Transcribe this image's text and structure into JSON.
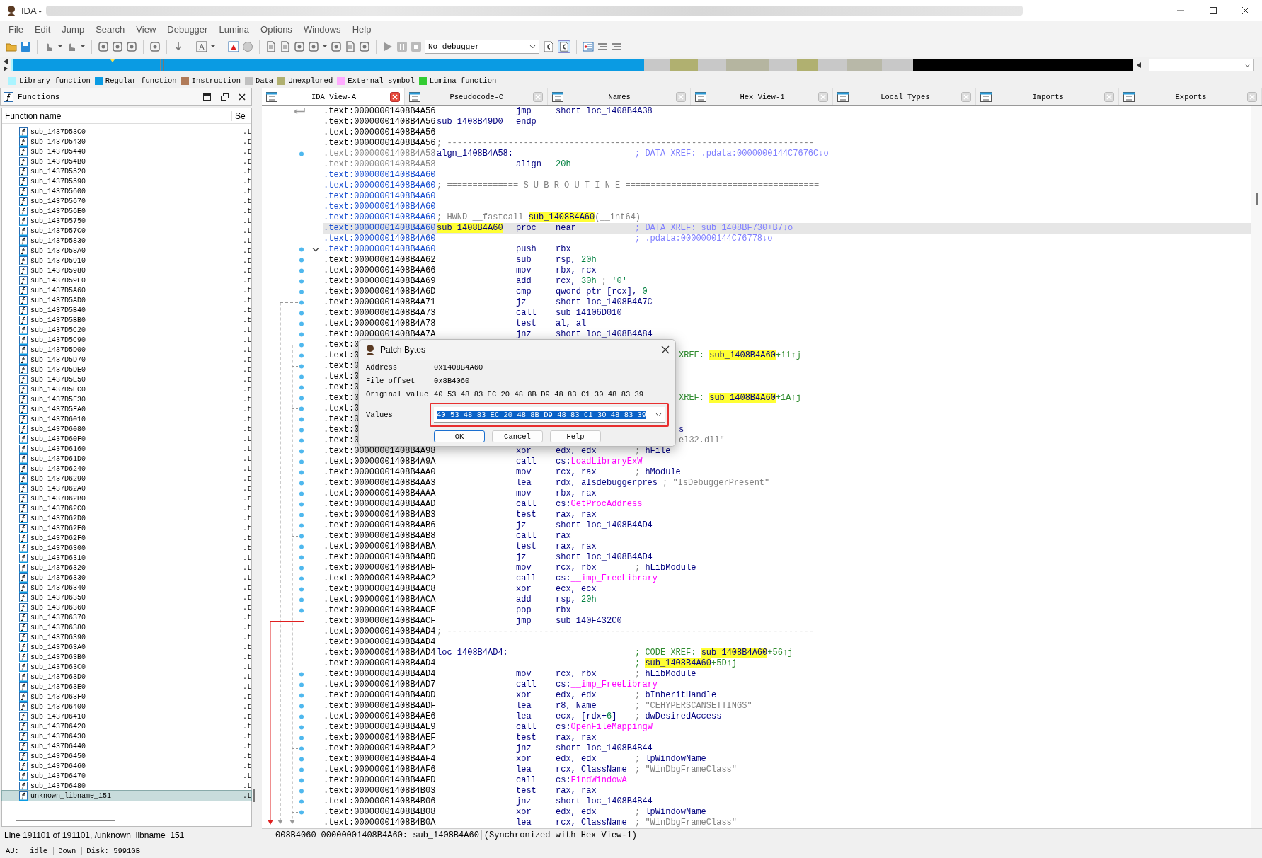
{
  "window": {
    "title": "IDA -"
  },
  "menu": [
    "File",
    "Edit",
    "Jump",
    "Search",
    "View",
    "Debugger",
    "Lumina",
    "Options",
    "Windows",
    "Help"
  ],
  "toolbar": {
    "debugger_select": "No debugger"
  },
  "legend": [
    {
      "label": "Library function",
      "color": "#aaf4ff"
    },
    {
      "label": "Regular function",
      "color": "#0a9be3"
    },
    {
      "label": "Instruction",
      "color": "#b07a58"
    },
    {
      "label": "Data",
      "color": "#c0c0c0"
    },
    {
      "label": "Unexplored",
      "color": "#b0b070"
    },
    {
      "label": "External symbol",
      "color": "#ffaaff"
    },
    {
      "label": "Lumina function",
      "color": "#33cc33"
    }
  ],
  "functions_panel": {
    "title": "Functions",
    "columns": [
      "Function name",
      "Se"
    ],
    "rows": [
      {
        "name": "sub_1437D53C0",
        "segment": ".t",
        "selected": false
      },
      {
        "name": "sub_1437D5430",
        "segment": ".t",
        "selected": false
      },
      {
        "name": "sub_1437D5440",
        "segment": ".t",
        "selected": false
      },
      {
        "name": "sub_1437D54B0",
        "segment": ".t",
        "selected": false
      },
      {
        "name": "sub_1437D5520",
        "segment": ".t",
        "selected": false
      },
      {
        "name": "sub_1437D5590",
        "segment": ".t",
        "selected": false
      },
      {
        "name": "sub_1437D5600",
        "segment": ".t",
        "selected": false
      },
      {
        "name": "sub_1437D5670",
        "segment": ".t",
        "selected": false
      },
      {
        "name": "sub_1437D56E0",
        "segment": ".t",
        "selected": false
      },
      {
        "name": "sub_1437D5750",
        "segment": ".t",
        "selected": false
      },
      {
        "name": "sub_1437D57C0",
        "segment": ".t",
        "selected": false
      },
      {
        "name": "sub_1437D5830",
        "segment": ".t",
        "selected": false
      },
      {
        "name": "sub_1437D58A0",
        "segment": ".t",
        "selected": false
      },
      {
        "name": "sub_1437D5910",
        "segment": ".t",
        "selected": false
      },
      {
        "name": "sub_1437D5980",
        "segment": ".t",
        "selected": false
      },
      {
        "name": "sub_1437D59F0",
        "segment": ".t",
        "selected": false
      },
      {
        "name": "sub_1437D5A60",
        "segment": ".t",
        "selected": false
      },
      {
        "name": "sub_1437D5AD0",
        "segment": ".t",
        "selected": false
      },
      {
        "name": "sub_1437D5B40",
        "segment": ".t",
        "selected": false
      },
      {
        "name": "sub_1437D5BB0",
        "segment": ".t",
        "selected": false
      },
      {
        "name": "sub_1437D5C20",
        "segment": ".t",
        "selected": false
      },
      {
        "name": "sub_1437D5C90",
        "segment": ".t",
        "selected": false
      },
      {
        "name": "sub_1437D5D00",
        "segment": ".t",
        "selected": false
      },
      {
        "name": "sub_1437D5D70",
        "segment": ".t",
        "selected": false
      },
      {
        "name": "sub_1437D5DE0",
        "segment": ".t",
        "selected": false
      },
      {
        "name": "sub_1437D5E50",
        "segment": ".t",
        "selected": false
      },
      {
        "name": "sub_1437D5EC0",
        "segment": ".t",
        "selected": false
      },
      {
        "name": "sub_1437D5F30",
        "segment": ".t",
        "selected": false
      },
      {
        "name": "sub_1437D5FA0",
        "segment": ".t",
        "selected": false
      },
      {
        "name": "sub_1437D6010",
        "segment": ".t",
        "selected": false
      },
      {
        "name": "sub_1437D6080",
        "segment": ".t",
        "selected": false
      },
      {
        "name": "sub_1437D60F0",
        "segment": ".t",
        "selected": false
      },
      {
        "name": "sub_1437D6160",
        "segment": ".t",
        "selected": false
      },
      {
        "name": "sub_1437D61D0",
        "segment": ".t",
        "selected": false
      },
      {
        "name": "sub_1437D6240",
        "segment": ".t",
        "selected": false
      },
      {
        "name": "sub_1437D6290",
        "segment": ".t",
        "selected": false
      },
      {
        "name": "sub_1437D62A0",
        "segment": ".t",
        "selected": false
      },
      {
        "name": "sub_1437D62B0",
        "segment": ".t",
        "selected": false
      },
      {
        "name": "sub_1437D62C0",
        "segment": ".t",
        "selected": false
      },
      {
        "name": "sub_1437D62D0",
        "segment": ".t",
        "selected": false
      },
      {
        "name": "sub_1437D62E0",
        "segment": ".t",
        "selected": false
      },
      {
        "name": "sub_1437D62F0",
        "segment": ".t",
        "selected": false
      },
      {
        "name": "sub_1437D6300",
        "segment": ".t",
        "selected": false
      },
      {
        "name": "sub_1437D6310",
        "segment": ".t",
        "selected": false
      },
      {
        "name": "sub_1437D6320",
        "segment": ".t",
        "selected": false
      },
      {
        "name": "sub_1437D6330",
        "segment": ".t",
        "selected": false
      },
      {
        "name": "sub_1437D6340",
        "segment": ".t",
        "selected": false
      },
      {
        "name": "sub_1437D6350",
        "segment": ".t",
        "selected": false
      },
      {
        "name": "sub_1437D6360",
        "segment": ".t",
        "selected": false
      },
      {
        "name": "sub_1437D6370",
        "segment": ".t",
        "selected": false
      },
      {
        "name": "sub_1437D6380",
        "segment": ".t",
        "selected": false
      },
      {
        "name": "sub_1437D6390",
        "segment": ".t",
        "selected": false
      },
      {
        "name": "sub_1437D63A0",
        "segment": ".t",
        "selected": false
      },
      {
        "name": "sub_1437D63B0",
        "segment": ".t",
        "selected": false
      },
      {
        "name": "sub_1437D63C0",
        "segment": ".t",
        "selected": false
      },
      {
        "name": "sub_1437D63D0",
        "segment": ".t",
        "selected": false
      },
      {
        "name": "sub_1437D63E0",
        "segment": ".t",
        "selected": false
      },
      {
        "name": "sub_1437D63F0",
        "segment": ".t",
        "selected": false
      },
      {
        "name": "sub_1437D6400",
        "segment": ".t",
        "selected": false
      },
      {
        "name": "sub_1437D6410",
        "segment": ".t",
        "selected": false
      },
      {
        "name": "sub_1437D6420",
        "segment": ".t",
        "selected": false
      },
      {
        "name": "sub_1437D6430",
        "segment": ".t",
        "selected": false
      },
      {
        "name": "sub_1437D6440",
        "segment": ".t",
        "selected": false
      },
      {
        "name": "sub_1437D6450",
        "segment": ".t",
        "selected": false
      },
      {
        "name": "sub_1437D6460",
        "segment": ".t",
        "selected": false
      },
      {
        "name": "sub_1437D6470",
        "segment": ".t",
        "selected": false
      },
      {
        "name": "sub_1437D6480",
        "segment": ".t",
        "selected": false
      },
      {
        "name": "unknown_libname_151",
        "segment": ".t",
        "selected": true
      }
    ],
    "status": "Line 191101 of 191101, /unknown_libname_151"
  },
  "tabs": [
    {
      "label": "IDA View-A",
      "selected": true
    },
    {
      "label": "Pseudocode-C",
      "selected": false
    },
    {
      "label": "Names",
      "selected": false
    },
    {
      "label": "Hex View-1",
      "selected": false
    },
    {
      "label": "Local Types",
      "selected": false
    },
    {
      "label": "Imports",
      "selected": false
    },
    {
      "label": "Exports",
      "selected": false
    }
  ],
  "listing": {
    "rows": [
      {
        "address": ".text:00000001408B4A56",
        "color": "#000000",
        "dot": false,
        "selected": false,
        "mnemonic": "jmp",
        "operands": [
          {
            "text": "short loc_1408B4A38",
            "kind": "name"
          }
        ]
      },
      {
        "address": ".text:00000001408B4A56",
        "color": "#000000",
        "dot": false,
        "selected": false,
        "label": [
          {
            "text": "sub_1408B49D0",
            "kind": "name"
          }
        ],
        "mnemonic": "endp"
      },
      {
        "address": ".text:00000001408B4A56",
        "color": "#000000",
        "dot": false,
        "selected": false
      },
      {
        "address": ".text:00000001408B4A56",
        "color": "#000000",
        "dot": false,
        "selected": false,
        "note": [
          {
            "text": "; ------------------------------------------------------------------------",
            "kind": "gray"
          }
        ]
      },
      {
        "address": ".text:00000001408B4A58",
        "color": "#888888",
        "dot": true,
        "selected": false,
        "label": [
          {
            "text": "algn_1408B4A58:",
            "kind": "name"
          }
        ],
        "comment": [
          {
            "text": "; DATA XREF: .pdata:0000000144C7676C↓o",
            "kind": "xref"
          }
        ]
      },
      {
        "address": ".text:00000001408B4A58",
        "color": "#888888",
        "dot": false,
        "selected": false,
        "mnemonic": "align",
        "operands": [
          {
            "text": "20h",
            "kind": "num"
          }
        ]
      },
      {
        "address": ".text:00000001408B4A60",
        "color": "#1a4fd0",
        "dot": false,
        "selected": false
      },
      {
        "address": ".text:00000001408B4A60",
        "color": "#1a4fd0",
        "dot": false,
        "selected": false,
        "note": [
          {
            "text": "; ============== S U B R O U T I N E ======================================",
            "kind": "gray"
          }
        ]
      },
      {
        "address": ".text:00000001408B4A60",
        "color": "#1a4fd0",
        "dot": false,
        "selected": false
      },
      {
        "address": ".text:00000001408B4A60",
        "color": "#1a4fd0",
        "dot": false,
        "selected": false
      },
      {
        "address": ".text:00000001408B4A60",
        "color": "#1a4fd0",
        "dot": false,
        "selected": false,
        "note": [
          {
            "text": "; HWND __fastcall ",
            "kind": "gray"
          },
          {
            "text": "sub_1408B4A60",
            "kind": "hl"
          },
          {
            "text": "(__int64)",
            "kind": "gray"
          }
        ]
      },
      {
        "address": ".text:00000001408B4A60",
        "color": "#1a4fd0",
        "dot": false,
        "selected": true,
        "label": [
          {
            "text": "sub_1408B4A60",
            "kind": "hl"
          }
        ],
        "mnemonic": "proc",
        "operands": [
          {
            "text": "near",
            "kind": "name"
          }
        ],
        "comment": [
          {
            "text": "; DATA XREF: sub_1408BF730+B7↓o",
            "kind": "xref"
          }
        ]
      },
      {
        "address": ".text:00000001408B4A60",
        "color": "#1a4fd0",
        "dot": false,
        "selected": false,
        "comment": [
          {
            "text": "; .pdata:0000000144C76778↓o",
            "kind": "xref"
          }
        ]
      },
      {
        "address": ".text:00000001408B4A60",
        "color": "#1a4fd0",
        "dot": true,
        "selected": false,
        "mnemonic": "push",
        "operands": [
          {
            "text": "rbx",
            "kind": "name"
          }
        ]
      },
      {
        "address": ".text:00000001408B4A62",
        "color": "#000000",
        "dot": true,
        "selected": false,
        "mnemonic": "sub",
        "operands": [
          {
            "text": "rsp, ",
            "kind": "name"
          },
          {
            "text": "20h",
            "kind": "num"
          }
        ]
      },
      {
        "address": ".text:00000001408B4A66",
        "color": "#000000",
        "dot": true,
        "selected": false,
        "mnemonic": "mov",
        "operands": [
          {
            "text": "rbx, rcx",
            "kind": "name"
          }
        ]
      },
      {
        "address": ".text:00000001408B4A69",
        "color": "#000000",
        "dot": true,
        "selected": false,
        "mnemonic": "add",
        "operands": [
          {
            "text": "rcx, ",
            "kind": "name"
          },
          {
            "text": "30h",
            "kind": "num"
          },
          {
            "text": " ; ",
            "kind": "gray"
          },
          {
            "text": "'0'",
            "kind": "num"
          }
        ]
      },
      {
        "address": ".text:00000001408B4A6D",
        "color": "#000000",
        "dot": true,
        "selected": false,
        "mnemonic": "cmp",
        "operands": [
          {
            "text": "qword ptr [rcx], ",
            "kind": "name"
          },
          {
            "text": "0",
            "kind": "num"
          }
        ]
      },
      {
        "address": ".text:00000001408B4A71",
        "color": "#000000",
        "dot": true,
        "selected": false,
        "mnemonic": "jz",
        "operands": [
          {
            "text": "short loc_1408B4A7C",
            "kind": "name"
          }
        ]
      },
      {
        "address": ".text:00000001408B4A73",
        "color": "#000000",
        "dot": true,
        "selected": false,
        "mnemonic": "call",
        "operands": [
          {
            "text": "sub_14106D010",
            "kind": "name"
          }
        ]
      },
      {
        "address": ".text:00000001408B4A78",
        "color": "#000000",
        "dot": true,
        "selected": false,
        "mnemonic": "test",
        "operands": [
          {
            "text": "al, al",
            "kind": "name"
          }
        ]
      },
      {
        "address": ".text:00000001408B4A7A",
        "color": "#000000",
        "dot": true,
        "selected": false,
        "mnemonic": "jnz",
        "operands": [
          {
            "text": "short loc_1408B4A84",
            "kind": "name"
          }
        ]
      },
      {
        "address": ".text:0",
        "color": "#000000",
        "dot": true,
        "selected": false,
        "covered": true
      },
      {
        "address": ".text:0",
        "color": "#000000",
        "dot": true,
        "selected": false,
        "covered": true,
        "comment": [
          {
            "text": "XREF: ",
            "kind": "code"
          },
          {
            "text": "sub_1408B4A60",
            "kind": "hl"
          },
          {
            "text": "+11↑j",
            "kind": "code"
          }
        ]
      },
      {
        "address": ".text:0",
        "color": "#000000",
        "dot": true,
        "selected": false,
        "covered": true
      },
      {
        "address": ".text:0",
        "color": "#000000",
        "dot": true,
        "selected": false,
        "covered": true
      },
      {
        "address": ".text:0",
        "color": "#000000",
        "dot": true,
        "selected": false,
        "covered": true
      },
      {
        "address": ".text:0",
        "color": "#000000",
        "dot": true,
        "selected": false,
        "covered": true,
        "comment": [
          {
            "text": "XREF: ",
            "kind": "code"
          },
          {
            "text": "sub_1408B4A60",
            "kind": "hl"
          },
          {
            "text": "+1A↑j",
            "kind": "code"
          }
        ]
      },
      {
        "address": ".text:0",
        "color": "#000000",
        "dot": true,
        "selected": false,
        "covered": true
      },
      {
        "address": ".text:0",
        "color": "#000000",
        "dot": true,
        "selected": false,
        "covered": true
      },
      {
        "address": ".text:0",
        "color": "#000000",
        "dot": true,
        "selected": false,
        "covered": true,
        "comment": [
          {
            "text": "s",
            "kind": "name"
          }
        ]
      },
      {
        "address": ".text:0",
        "color": "#000000",
        "dot": true,
        "selected": false,
        "covered": true,
        "comment": [
          {
            "text": "el32.dll\"",
            "kind": "gray"
          }
        ]
      },
      {
        "address": ".text:00000001408B4A98",
        "color": "#000000",
        "dot": true,
        "selected": false,
        "mnemonic": "xor",
        "operands": [
          {
            "text": "edx, edx",
            "kind": "name"
          }
        ],
        "comment": [
          {
            "text": "; ",
            "kind": "gray"
          },
          {
            "text": "hFile",
            "kind": "name"
          }
        ]
      },
      {
        "address": ".text:00000001408B4A9A",
        "color": "#000000",
        "dot": true,
        "selected": false,
        "mnemonic": "call",
        "operands": [
          {
            "text": "cs:",
            "kind": "name"
          },
          {
            "text": "LoadLibraryExW",
            "kind": "import"
          }
        ]
      },
      {
        "address": ".text:00000001408B4AA0",
        "color": "#000000",
        "dot": true,
        "selected": false,
        "mnemonic": "mov",
        "operands": [
          {
            "text": "rcx, rax",
            "kind": "name"
          }
        ],
        "comment": [
          {
            "text": "; ",
            "kind": "gray"
          },
          {
            "text": "hModule",
            "kind": "name"
          }
        ]
      },
      {
        "address": ".text:00000001408B4AA3",
        "color": "#000000",
        "dot": true,
        "selected": false,
        "mnemonic": "lea",
        "operands": [
          {
            "text": "rdx, aIsdebuggerpres",
            "kind": "name"
          }
        ],
        "comment": [
          {
            "text": "; \"IsDebuggerPresent\"",
            "kind": "gray"
          }
        ]
      },
      {
        "address": ".text:00000001408B4AAA",
        "color": "#000000",
        "dot": true,
        "selected": false,
        "mnemonic": "mov",
        "operands": [
          {
            "text": "rbx, rax",
            "kind": "name"
          }
        ]
      },
      {
        "address": ".text:00000001408B4AAD",
        "color": "#000000",
        "dot": true,
        "selected": false,
        "mnemonic": "call",
        "operands": [
          {
            "text": "cs:",
            "kind": "name"
          },
          {
            "text": "GetProcAddress",
            "kind": "import"
          }
        ]
      },
      {
        "address": ".text:00000001408B4AB3",
        "color": "#000000",
        "dot": true,
        "selected": false,
        "mnemonic": "test",
        "operands": [
          {
            "text": "rax, rax",
            "kind": "name"
          }
        ]
      },
      {
        "address": ".text:00000001408B4AB6",
        "color": "#000000",
        "dot": true,
        "selected": false,
        "mnemonic": "jz",
        "operands": [
          {
            "text": "short loc_1408B4AD4",
            "kind": "name"
          }
        ]
      },
      {
        "address": ".text:00000001408B4AB8",
        "color": "#000000",
        "dot": true,
        "selected": false,
        "mnemonic": "call",
        "operands": [
          {
            "text": "rax",
            "kind": "name"
          }
        ]
      },
      {
        "address": ".text:00000001408B4ABA",
        "color": "#000000",
        "dot": true,
        "selected": false,
        "mnemonic": "test",
        "operands": [
          {
            "text": "rax, rax",
            "kind": "name"
          }
        ]
      },
      {
        "address": ".text:00000001408B4ABD",
        "color": "#000000",
        "dot": true,
        "selected": false,
        "mnemonic": "jz",
        "operands": [
          {
            "text": "short loc_1408B4AD4",
            "kind": "name"
          }
        ]
      },
      {
        "address": ".text:00000001408B4ABF",
        "color": "#000000",
        "dot": true,
        "selected": false,
        "mnemonic": "mov",
        "operands": [
          {
            "text": "rcx, rbx",
            "kind": "name"
          }
        ],
        "comment": [
          {
            "text": "; ",
            "kind": "gray"
          },
          {
            "text": "hLibModule",
            "kind": "name"
          }
        ]
      },
      {
        "address": ".text:00000001408B4AC2",
        "color": "#000000",
        "dot": true,
        "selected": false,
        "mnemonic": "call",
        "operands": [
          {
            "text": "cs:",
            "kind": "name"
          },
          {
            "text": "__imp_FreeLibrary",
            "kind": "import"
          }
        ]
      },
      {
        "address": ".text:00000001408B4AC8",
        "color": "#000000",
        "dot": true,
        "selected": false,
        "mnemonic": "xor",
        "operands": [
          {
            "text": "ecx, ecx",
            "kind": "name"
          }
        ]
      },
      {
        "address": ".text:00000001408B4ACA",
        "color": "#000000",
        "dot": true,
        "selected": false,
        "mnemonic": "add",
        "operands": [
          {
            "text": "rsp, ",
            "kind": "name"
          },
          {
            "text": "20h",
            "kind": "num"
          }
        ]
      },
      {
        "address": ".text:00000001408B4ACE",
        "color": "#000000",
        "dot": true,
        "selected": false,
        "mnemonic": "pop",
        "operands": [
          {
            "text": "rbx",
            "kind": "name"
          }
        ]
      },
      {
        "address": ".text:00000001408B4ACF",
        "color": "#000000",
        "dot": false,
        "selected": false,
        "mnemonic": "jmp",
        "operands": [
          {
            "text": "sub_140F432C0",
            "kind": "name"
          }
        ]
      },
      {
        "address": ".text:00000001408B4AD4",
        "color": "#000000",
        "dot": false,
        "selected": false,
        "note": [
          {
            "text": "; ------------------------------------------------------------------------",
            "kind": "gray"
          }
        ]
      },
      {
        "address": ".text:00000001408B4AD4",
        "color": "#000000",
        "dot": false,
        "selected": false
      },
      {
        "address": ".text:00000001408B4AD4",
        "color": "#000000",
        "dot": false,
        "selected": false,
        "label": [
          {
            "text": "loc_1408B4AD4:",
            "kind": "name"
          }
        ],
        "comment": [
          {
            "text": "; CODE XREF: ",
            "kind": "code"
          },
          {
            "text": "sub_1408B4A60",
            "kind": "hl"
          },
          {
            "text": "+56↑j",
            "kind": "code"
          }
        ]
      },
      {
        "address": ".text:00000001408B4AD4",
        "color": "#000000",
        "dot": false,
        "selected": false,
        "comment": [
          {
            "text": "; ",
            "kind": "code"
          },
          {
            "text": "sub_1408B4A60",
            "kind": "hl"
          },
          {
            "text": "+5D↑j",
            "kind": "code"
          }
        ]
      },
      {
        "address": ".text:00000001408B4AD4",
        "color": "#000000",
        "dot": true,
        "selected": false,
        "mnemonic": "mov",
        "operands": [
          {
            "text": "rcx, rbx",
            "kind": "name"
          }
        ],
        "comment": [
          {
            "text": "; ",
            "kind": "gray"
          },
          {
            "text": "hLibModule",
            "kind": "name"
          }
        ]
      },
      {
        "address": ".text:00000001408B4AD7",
        "color": "#000000",
        "dot": true,
        "selected": false,
        "mnemonic": "call",
        "operands": [
          {
            "text": "cs:",
            "kind": "name"
          },
          {
            "text": "__imp_FreeLibrary",
            "kind": "import"
          }
        ]
      },
      {
        "address": ".text:00000001408B4ADD",
        "color": "#000000",
        "dot": true,
        "selected": false,
        "mnemonic": "xor",
        "operands": [
          {
            "text": "edx, edx",
            "kind": "name"
          }
        ],
        "comment": [
          {
            "text": "; ",
            "kind": "gray"
          },
          {
            "text": "bInheritHandle",
            "kind": "name"
          }
        ]
      },
      {
        "address": ".text:00000001408B4ADF",
        "color": "#000000",
        "dot": true,
        "selected": false,
        "mnemonic": "lea",
        "operands": [
          {
            "text": "r8, Name",
            "kind": "name"
          }
        ],
        "comment": [
          {
            "text": "; \"CEHYPERSCANSETTINGS\"",
            "kind": "gray"
          }
        ]
      },
      {
        "address": ".text:00000001408B4AE6",
        "color": "#000000",
        "dot": true,
        "selected": false,
        "mnemonic": "lea",
        "operands": [
          {
            "text": "ecx, [rdx+",
            "kind": "name"
          },
          {
            "text": "6",
            "kind": "num"
          },
          {
            "text": "]",
            "kind": "name"
          }
        ],
        "comment": [
          {
            "text": "; ",
            "kind": "gray"
          },
          {
            "text": "dwDesiredAccess",
            "kind": "name"
          }
        ]
      },
      {
        "address": ".text:00000001408B4AE9",
        "color": "#000000",
        "dot": true,
        "selected": false,
        "mnemonic": "call",
        "operands": [
          {
            "text": "cs:",
            "kind": "name"
          },
          {
            "text": "OpenFileMappingW",
            "kind": "import"
          }
        ]
      },
      {
        "address": ".text:00000001408B4AEF",
        "color": "#000000",
        "dot": true,
        "selected": false,
        "mnemonic": "test",
        "operands": [
          {
            "text": "rax, rax",
            "kind": "name"
          }
        ]
      },
      {
        "address": ".text:00000001408B4AF2",
        "color": "#000000",
        "dot": true,
        "selected": false,
        "mnemonic": "jnz",
        "operands": [
          {
            "text": "short loc_1408B4B44",
            "kind": "name"
          }
        ]
      },
      {
        "address": ".text:00000001408B4AF4",
        "color": "#000000",
        "dot": true,
        "selected": false,
        "mnemonic": "xor",
        "operands": [
          {
            "text": "edx, edx",
            "kind": "name"
          }
        ],
        "comment": [
          {
            "text": "; ",
            "kind": "gray"
          },
          {
            "text": "lpWindowName",
            "kind": "name"
          }
        ]
      },
      {
        "address": ".text:00000001408B4AF6",
        "color": "#000000",
        "dot": true,
        "selected": false,
        "mnemonic": "lea",
        "operands": [
          {
            "text": "rcx, ClassName",
            "kind": "name"
          }
        ],
        "comment": [
          {
            "text": "; \"WinDbgFrameClass\"",
            "kind": "gray"
          }
        ]
      },
      {
        "address": ".text:00000001408B4AFD",
        "color": "#000000",
        "dot": true,
        "selected": false,
        "mnemonic": "call",
        "operands": [
          {
            "text": "cs:",
            "kind": "name"
          },
          {
            "text": "FindWindowA",
            "kind": "import"
          }
        ]
      },
      {
        "address": ".text:00000001408B4B03",
        "color": "#000000",
        "dot": true,
        "selected": false,
        "mnemonic": "test",
        "operands": [
          {
            "text": "rax, rax",
            "kind": "name"
          }
        ]
      },
      {
        "address": ".text:00000001408B4B06",
        "color": "#000000",
        "dot": true,
        "selected": false,
        "mnemonic": "jnz",
        "operands": [
          {
            "text": "short loc_1408B4B44",
            "kind": "name"
          }
        ]
      },
      {
        "address": ".text:00000001408B4B08",
        "color": "#000000",
        "dot": true,
        "selected": false,
        "mnemonic": "xor",
        "operands": [
          {
            "text": "edx, edx",
            "kind": "name"
          }
        ],
        "comment": [
          {
            "text": "; ",
            "kind": "gray"
          },
          {
            "text": "lpWindowName",
            "kind": "name"
          }
        ]
      },
      {
        "address": ".text:00000001408B4B0A",
        "color": "#000000",
        "dot": false,
        "selected": false,
        "mnemonic": "lea",
        "operands": [
          {
            "text": "rcx, ClassName",
            "kind": "name"
          }
        ],
        "comment": [
          {
            "text": "; \"WinDbgFrameClass\"",
            "kind": "gray"
          }
        ]
      }
    ],
    "status": [
      "008B4060",
      "00000001408B4A60: sub_1408B4A60",
      "(Synchronized with Hex View-1)"
    ]
  },
  "dialog": {
    "title": "Patch Bytes",
    "fields": [
      {
        "label": "Address",
        "value": "0x1408B4A60"
      },
      {
        "label": "File offset",
        "value": "0x8B4060"
      },
      {
        "label": "Original value",
        "value": "40 53 48 83 EC 20 48 8B D9 48 83 C1 30 48 83 39"
      }
    ],
    "values": {
      "label": "Values",
      "value": "40 53 48 83 EC 20 48 8B D9 48 83 C1 30 48 83 39",
      "selected": true,
      "marked": true
    },
    "buttons": [
      {
        "label": "OK",
        "default": true
      },
      {
        "label": "Cancel",
        "default": false
      },
      {
        "label": "Help",
        "default": false
      }
    ]
  },
  "status_bar": [
    {
      "text": "AU:",
      "divider": false
    },
    {
      "text": "idle",
      "divider": true
    },
    {
      "text": "Down",
      "divider": true
    },
    {
      "text": "Disk: 5991GB",
      "divider": true
    }
  ]
}
